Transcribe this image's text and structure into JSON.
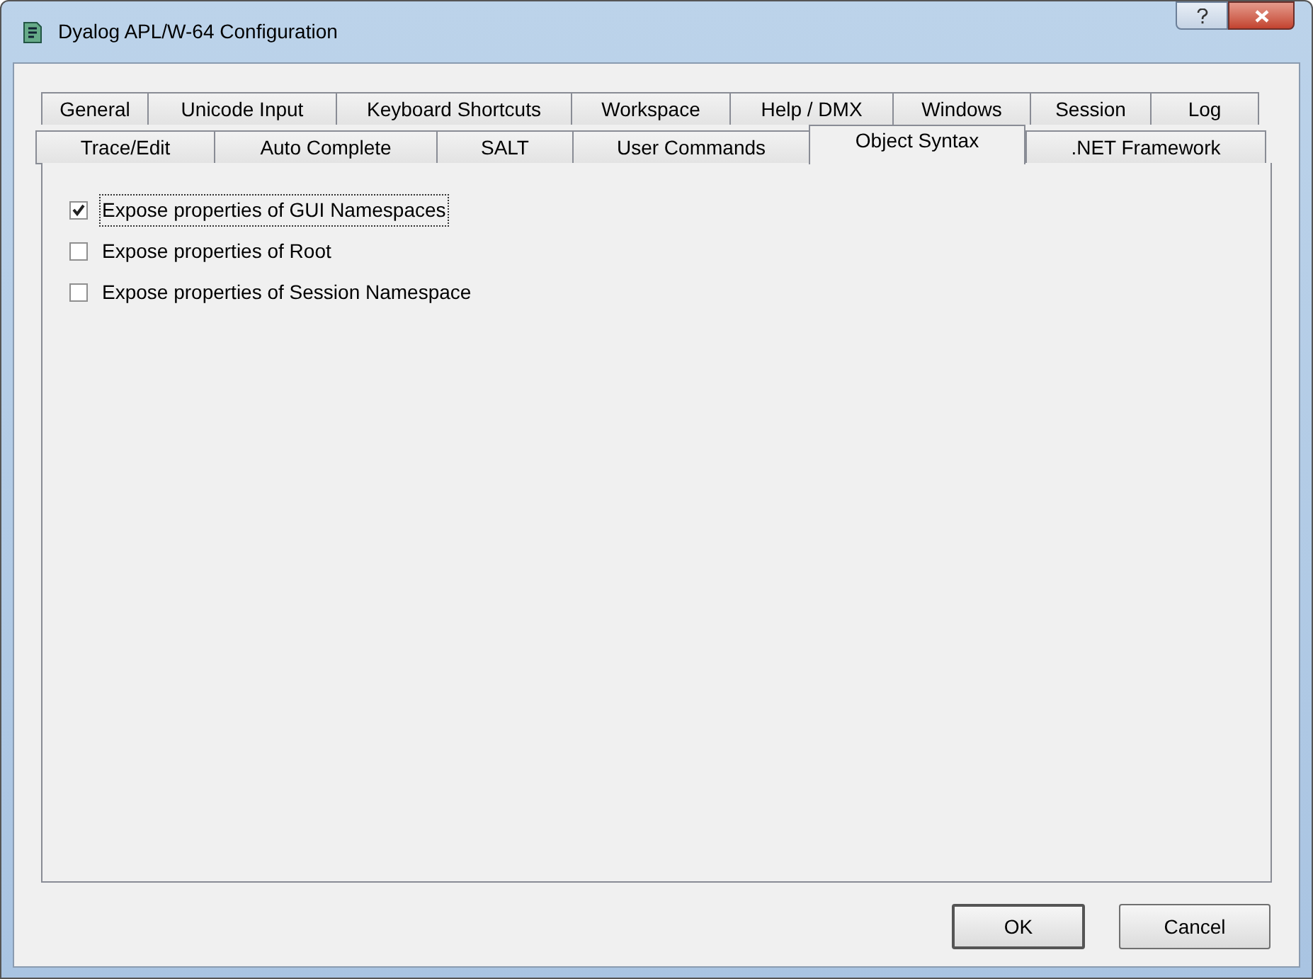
{
  "window": {
    "title": "Dyalog APL/W-64 Configuration"
  },
  "tab_rows": [
    [
      {
        "label": "General",
        "selected": false
      },
      {
        "label": "Unicode Input",
        "selected": false
      },
      {
        "label": "Keyboard Shortcuts",
        "selected": false
      },
      {
        "label": "Workspace",
        "selected": false
      },
      {
        "label": "Help / DMX",
        "selected": false
      },
      {
        "label": "Windows",
        "selected": false
      },
      {
        "label": "Session",
        "selected": false
      },
      {
        "label": "Log",
        "selected": false
      }
    ],
    [
      {
        "label": "Trace/Edit",
        "selected": false
      },
      {
        "label": "Auto Complete",
        "selected": false
      },
      {
        "label": "SALT",
        "selected": false
      },
      {
        "label": "User Commands",
        "selected": false
      },
      {
        "label": "Object Syntax",
        "selected": true
      },
      {
        "label": ".NET Framework",
        "selected": false
      }
    ]
  ],
  "options": [
    {
      "label": "Expose properties of GUI Namespaces",
      "checked": true,
      "focused": true
    },
    {
      "label": "Expose properties of Root",
      "checked": false,
      "focused": false
    },
    {
      "label": "Expose properties of Session Namespace",
      "checked": false,
      "focused": false
    }
  ],
  "buttons": [
    {
      "label": "OK",
      "default": true
    },
    {
      "label": "Cancel",
      "default": false
    }
  ]
}
